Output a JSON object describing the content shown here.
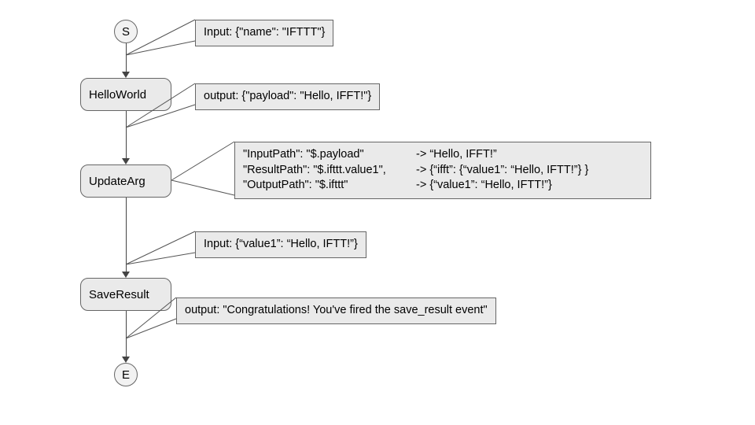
{
  "terminals": {
    "start": "S",
    "end": "E"
  },
  "steps": {
    "hello": "HelloWorld",
    "update": "UpdateArg",
    "save": "SaveResult"
  },
  "callouts": {
    "input1": "Input: {\"name\": \"IFTTT\"}",
    "output1": "output: {\"payload\": \"Hello, IFFT!\"}",
    "update_l1a": "\"InputPath\": \"$.payload\"",
    "update_l1b": "-> “Hello, IFFT!”",
    "update_l2a": "\"ResultPath\": \"$.ifttt.value1\",",
    "update_l2b": "-> {“ifft”: {“value1”: “Hello, IFTT!”} }",
    "update_l3a": "\"OutputPath\": \"$.ifttt\"",
    "update_l3b": "-> {“value1”: “Hello, IFTT!”}",
    "input2": "Input: {“value1”: “Hello, IFTT!”}",
    "output2": "output: \"Congratulations! You've fired the save_result event\""
  }
}
